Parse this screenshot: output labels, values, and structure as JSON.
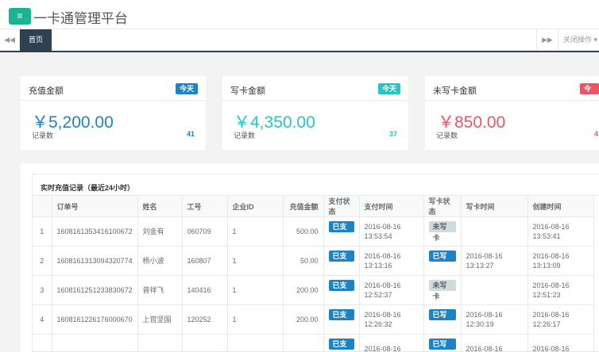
{
  "header": {
    "menu_icon": "≡",
    "title": "一卡通管理平台"
  },
  "tabs": {
    "prev_icon": "◀◀",
    "home_label": "首页",
    "next_icon": "▶▶",
    "close_ops": "关闭操作 ▾"
  },
  "cards": [
    {
      "title": "充值金额",
      "badge": "今天",
      "badge_color": "#1c84c6",
      "value": "￥5,200.00",
      "value_color": "#1c84c6",
      "sub": "记录数",
      "count": "41"
    },
    {
      "title": "写卡金额",
      "badge": "今天",
      "badge_color": "#23c6c8",
      "value": "￥4,350.00",
      "value_color": "#23c6c8",
      "sub": "记录数",
      "count": "37"
    },
    {
      "title": "未写卡金额",
      "badge": "今天",
      "badge_color": "#ed5565",
      "value": "￥850.00",
      "value_color": "#ed5565",
      "sub": "记录数",
      "count": "4"
    }
  ],
  "panel": {
    "title": "实时充值记录（最近24小时）",
    "columns": [
      "",
      "订单号",
      "姓名",
      "工号",
      "企业ID",
      "充值金额",
      "支付状态",
      "支付时间",
      "写卡状态",
      "写卡时间",
      "创建时间"
    ],
    "rows": [
      {
        "idx": "1",
        "order": "1608161353416100672",
        "name": "刘金有",
        "emp": "060709",
        "company": "1",
        "amount": "500.00",
        "pay_status": "已支付",
        "pay_time": [
          "2016-08-16",
          "13:53:54"
        ],
        "write_status": "未写卡",
        "write_done": false,
        "write_time": [
          "",
          ""
        ],
        "created": [
          "2016-08-16",
          "13:53:41"
        ]
      },
      {
        "idx": "2",
        "order": "1608161313094320774",
        "name": "杨小波",
        "emp": "160807",
        "company": "1",
        "amount": "50.00",
        "pay_status": "已支付",
        "pay_time": [
          "2016-08-16",
          "13:13:16"
        ],
        "write_status": "已写卡",
        "write_done": true,
        "write_time": [
          "2016-08-16",
          "13:13:27"
        ],
        "created": [
          "2016-08-16",
          "13:13:09"
        ]
      },
      {
        "idx": "3",
        "order": "1608161251233830672",
        "name": "曾祥飞",
        "emp": "140416",
        "company": "1",
        "amount": "200.00",
        "pay_status": "已支付",
        "pay_time": [
          "2016-08-16",
          "12:52:37"
        ],
        "write_status": "未写卡",
        "write_done": false,
        "write_time": [
          "",
          ""
        ],
        "created": [
          "2016-08-16",
          "12:51:23"
        ]
      },
      {
        "idx": "4",
        "order": "1608161226176000670",
        "name": "上官坚国",
        "emp": "120252",
        "company": "1",
        "amount": "200.00",
        "pay_status": "已支付",
        "pay_time": [
          "2016-08-16",
          "12:26:32"
        ],
        "write_status": "已写卡",
        "write_done": true,
        "write_time": [
          "2016-08-16",
          "12:30:19"
        ],
        "created": [
          "2016-08-16",
          "12:26:17"
        ]
      },
      {
        "idx": "",
        "order": "",
        "name": "",
        "emp": "",
        "company": "",
        "amount": "",
        "pay_status": "已支付",
        "pay_time": [
          "2016-08-16",
          ""
        ],
        "write_status": "已写卡",
        "write_done": true,
        "write_time": [
          "2016-08-16",
          ""
        ],
        "created": [
          "2016-08-16",
          ""
        ]
      }
    ]
  }
}
